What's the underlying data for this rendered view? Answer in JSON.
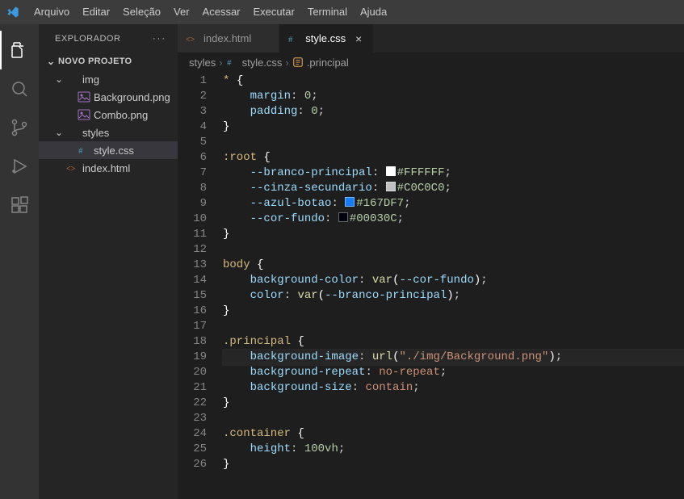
{
  "menu": {
    "items": [
      "Arquivo",
      "Editar",
      "Seleção",
      "Ver",
      "Acessar",
      "Executar",
      "Terminal",
      "Ajuda"
    ]
  },
  "sidebar": {
    "title": "EXPLORADOR",
    "project": "NOVO PROJETO",
    "tree": [
      {
        "type": "folder",
        "name": "img",
        "open": true,
        "indent": 1
      },
      {
        "type": "file",
        "name": "Background.png",
        "icon": "image",
        "indent": 2
      },
      {
        "type": "file",
        "name": "Combo.png",
        "icon": "image",
        "indent": 2
      },
      {
        "type": "folder",
        "name": "styles",
        "open": true,
        "indent": 1
      },
      {
        "type": "file",
        "name": "style.css",
        "icon": "css",
        "indent": 2,
        "selected": true
      },
      {
        "type": "file",
        "name": "index.html",
        "icon": "html",
        "indent": 1
      }
    ]
  },
  "tabs": [
    {
      "label": "index.html",
      "icon": "html",
      "active": false
    },
    {
      "label": "style.css",
      "icon": "css",
      "active": true
    }
  ],
  "breadcrumb": [
    {
      "label": "styles",
      "icon": null
    },
    {
      "label": "style.css",
      "icon": "css"
    },
    {
      "label": ".principal",
      "icon": "symbol"
    }
  ],
  "code": {
    "current_line": 19,
    "lines": [
      [
        {
          "t": "sel",
          "v": "*"
        },
        {
          "t": "white",
          "v": " "
        },
        {
          "t": "punc",
          "v": "{"
        }
      ],
      [
        {
          "t": "white",
          "v": "    "
        },
        {
          "t": "prop",
          "v": "margin"
        },
        {
          "t": "white",
          "v": ": "
        },
        {
          "t": "num",
          "v": "0"
        },
        {
          "t": "white",
          "v": ";"
        }
      ],
      [
        {
          "t": "white",
          "v": "    "
        },
        {
          "t": "prop",
          "v": "padding"
        },
        {
          "t": "white",
          "v": ": "
        },
        {
          "t": "num",
          "v": "0"
        },
        {
          "t": "white",
          "v": ";"
        }
      ],
      [
        {
          "t": "punc",
          "v": "}"
        }
      ],
      [],
      [
        {
          "t": "sel",
          "v": ":root"
        },
        {
          "t": "white",
          "v": " "
        },
        {
          "t": "punc",
          "v": "{"
        }
      ],
      [
        {
          "t": "white",
          "v": "    "
        },
        {
          "t": "var",
          "v": "--branco-principal"
        },
        {
          "t": "white",
          "v": ": "
        },
        {
          "t": "swatch",
          "v": "#FFFFFF"
        },
        {
          "t": "num",
          "v": "#FFFFFF"
        },
        {
          "t": "white",
          "v": ";"
        }
      ],
      [
        {
          "t": "white",
          "v": "    "
        },
        {
          "t": "var",
          "v": "--cinza-secundario"
        },
        {
          "t": "white",
          "v": ": "
        },
        {
          "t": "swatch",
          "v": "#C0C0C0"
        },
        {
          "t": "num",
          "v": "#C0C0C0"
        },
        {
          "t": "white",
          "v": ";"
        }
      ],
      [
        {
          "t": "white",
          "v": "    "
        },
        {
          "t": "var",
          "v": "--azul-botao"
        },
        {
          "t": "white",
          "v": ": "
        },
        {
          "t": "swatch",
          "v": "#167DF7"
        },
        {
          "t": "num",
          "v": "#167DF7"
        },
        {
          "t": "white",
          "v": ";"
        }
      ],
      [
        {
          "t": "white",
          "v": "    "
        },
        {
          "t": "var",
          "v": "--cor-fundo"
        },
        {
          "t": "white",
          "v": ": "
        },
        {
          "t": "swatch",
          "v": "#00030C"
        },
        {
          "t": "num",
          "v": "#00030C"
        },
        {
          "t": "white",
          "v": ";"
        }
      ],
      [
        {
          "t": "punc",
          "v": "}"
        }
      ],
      [],
      [
        {
          "t": "sel",
          "v": "body"
        },
        {
          "t": "white",
          "v": " "
        },
        {
          "t": "punc",
          "v": "{"
        }
      ],
      [
        {
          "t": "white",
          "v": "    "
        },
        {
          "t": "prop",
          "v": "background-color"
        },
        {
          "t": "white",
          "v": ": "
        },
        {
          "t": "func",
          "v": "var"
        },
        {
          "t": "punc",
          "v": "("
        },
        {
          "t": "var",
          "v": "--cor-fundo"
        },
        {
          "t": "punc",
          "v": ")"
        },
        {
          "t": "white",
          "v": ";"
        }
      ],
      [
        {
          "t": "white",
          "v": "    "
        },
        {
          "t": "prop",
          "v": "color"
        },
        {
          "t": "white",
          "v": ": "
        },
        {
          "t": "func",
          "v": "var"
        },
        {
          "t": "punc",
          "v": "("
        },
        {
          "t": "var",
          "v": "--branco-principal"
        },
        {
          "t": "punc",
          "v": ")"
        },
        {
          "t": "white",
          "v": ";"
        }
      ],
      [
        {
          "t": "punc",
          "v": "}"
        }
      ],
      [],
      [
        {
          "t": "sel",
          "v": ".principal"
        },
        {
          "t": "white",
          "v": " "
        },
        {
          "t": "punc",
          "v": "{"
        }
      ],
      [
        {
          "t": "white",
          "v": "    "
        },
        {
          "t": "prop",
          "v": "background-image"
        },
        {
          "t": "white",
          "v": ": "
        },
        {
          "t": "func",
          "v": "url"
        },
        {
          "t": "punc",
          "v": "("
        },
        {
          "t": "str",
          "v": "\"./img/Background.png\""
        },
        {
          "t": "punc",
          "v": ")"
        },
        {
          "t": "white",
          "v": ";"
        }
      ],
      [
        {
          "t": "white",
          "v": "    "
        },
        {
          "t": "prop",
          "v": "background-repeat"
        },
        {
          "t": "white",
          "v": ": "
        },
        {
          "t": "str",
          "v": "no-repeat"
        },
        {
          "t": "white",
          "v": ";"
        }
      ],
      [
        {
          "t": "white",
          "v": "    "
        },
        {
          "t": "prop",
          "v": "background-size"
        },
        {
          "t": "white",
          "v": ": "
        },
        {
          "t": "str",
          "v": "contain"
        },
        {
          "t": "white",
          "v": ";"
        }
      ],
      [
        {
          "t": "punc",
          "v": "}"
        }
      ],
      [],
      [
        {
          "t": "sel",
          "v": ".container"
        },
        {
          "t": "white",
          "v": " "
        },
        {
          "t": "punc",
          "v": "{"
        }
      ],
      [
        {
          "t": "white",
          "v": "    "
        },
        {
          "t": "prop",
          "v": "height"
        },
        {
          "t": "white",
          "v": ": "
        },
        {
          "t": "num",
          "v": "100vh"
        },
        {
          "t": "white",
          "v": ";"
        }
      ],
      [
        {
          "t": "punc",
          "v": "}"
        }
      ]
    ]
  }
}
